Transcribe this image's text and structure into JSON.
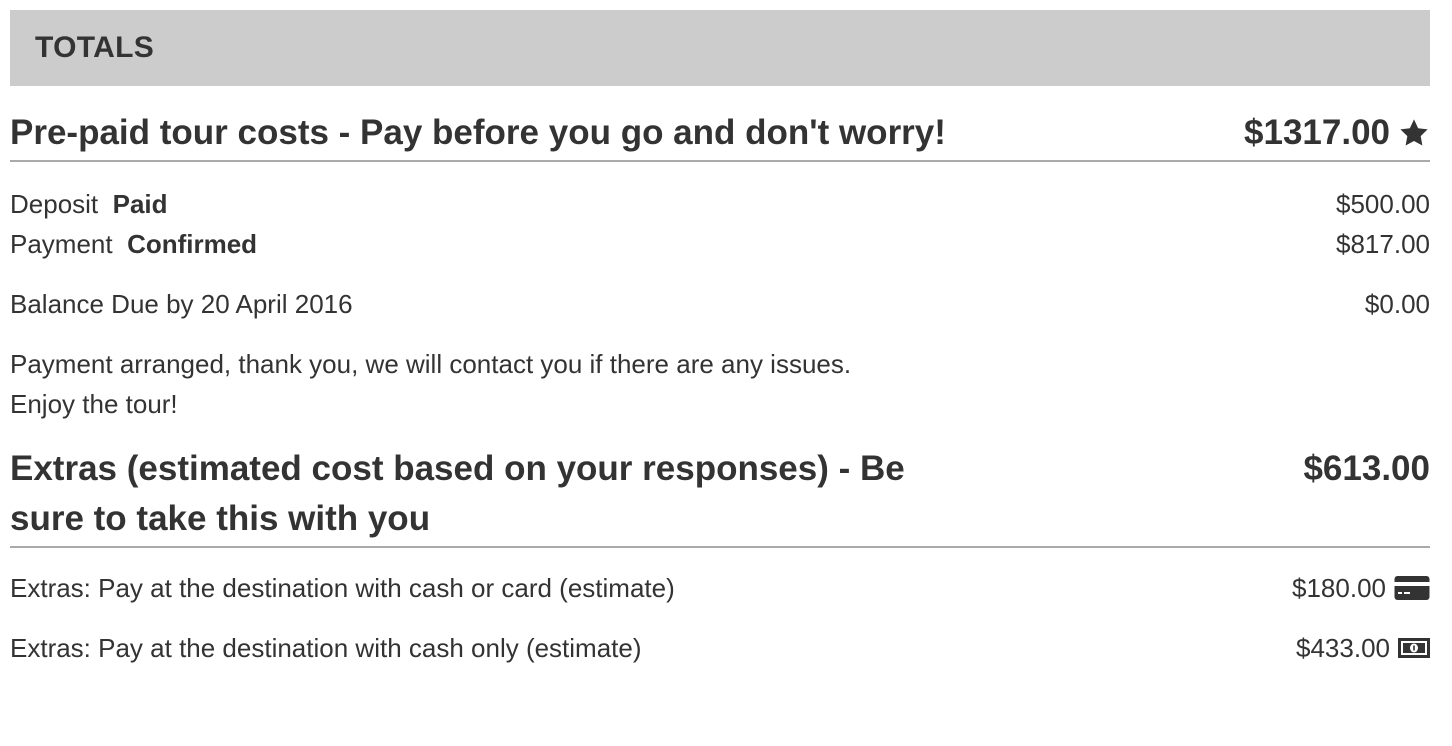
{
  "header": {
    "title": "TOTALS"
  },
  "prepaid": {
    "label": "Pre-paid tour costs - Pay before you go and don't worry!",
    "amount": "$1317.00",
    "icon": "star-icon",
    "rows": [
      {
        "label": "Deposit",
        "status": "Paid",
        "amount": "$500.00"
      },
      {
        "label": "Payment",
        "status": "Confirmed",
        "amount": "$817.00"
      }
    ],
    "balance": {
      "label": "Balance Due by 20 April 2016",
      "amount": "$0.00"
    },
    "message_line1": "Payment arranged, thank you, we will contact you if there are any issues.",
    "message_line2": "Enjoy the tour!"
  },
  "extras": {
    "label": "Extras (estimated cost based on your responses) - Be sure to take this with you",
    "amount": "$613.00",
    "rows": [
      {
        "label": "Extras: Pay at the destination with cash or card (estimate)",
        "amount": "$180.00",
        "icon": "credit-card-icon"
      },
      {
        "label": "Extras: Pay at the destination with cash only (estimate)",
        "amount": "$433.00",
        "icon": "banknote-icon"
      }
    ]
  },
  "colors": {
    "header_bg": "#cccccc",
    "text": "#333333",
    "divider": "#aaaaaa"
  }
}
